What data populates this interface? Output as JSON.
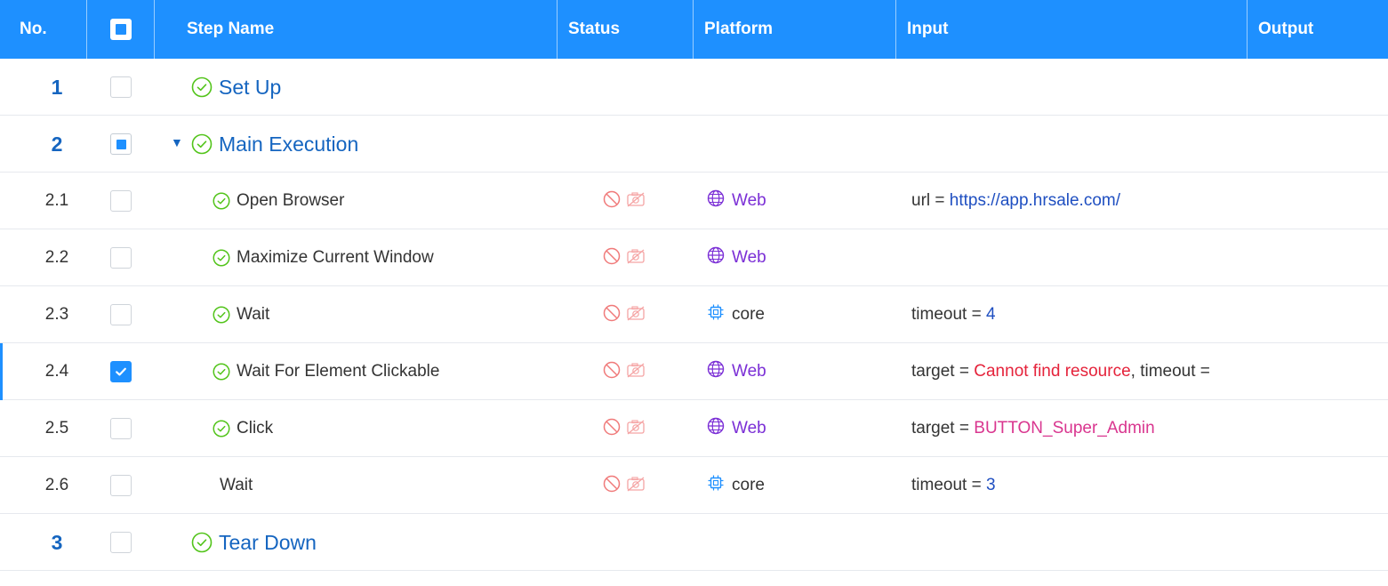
{
  "header": {
    "no": "No.",
    "step_name": "Step Name",
    "status": "Status",
    "platform": "Platform",
    "input": "Input",
    "output": "Output"
  },
  "rows": [
    {
      "no": "1",
      "name": "Set Up"
    },
    {
      "no": "2",
      "name": "Main Execution"
    },
    {
      "no": "2.1",
      "name": "Open Browser",
      "platform": "Web",
      "input_key": "url",
      "input_eq": "=",
      "input_value": "https://app.hrsale.com/"
    },
    {
      "no": "2.2",
      "name": "Maximize Current Window",
      "platform": "Web"
    },
    {
      "no": "2.3",
      "name": "Wait",
      "platform": "core",
      "input_key": "timeout",
      "input_eq": "=",
      "input_value": "4"
    },
    {
      "no": "2.4",
      "name": "Wait For Element Clickable",
      "platform": "Web",
      "input_key": "target",
      "input_eq": "=",
      "input_value": "Cannot find resource",
      "input_extra": ", timeout ="
    },
    {
      "no": "2.5",
      "name": "Click",
      "platform": "Web",
      "input_key": "target",
      "input_eq": "=",
      "input_value": "BUTTON_Super_Admin"
    },
    {
      "no": "2.6",
      "name": "Wait",
      "platform": "core",
      "input_key": "timeout",
      "input_eq": "=",
      "input_value": "3"
    },
    {
      "no": "3",
      "name": "Tear Down"
    }
  ],
  "icons": {
    "passed": "check-circle-icon",
    "disabled": "ban-icon",
    "no-screenshot": "camera-off-icon",
    "web": "globe-icon",
    "core": "chip-icon",
    "expand": "caret-down-icon"
  },
  "colors": {
    "header_bg": "#1e90ff",
    "group_text": "#1565c0",
    "success": "#52c41a",
    "web": "#7b2fd6",
    "core": "#1e90ff",
    "error": "#e5233b",
    "object": "#d9368f",
    "link": "#1f4fc1",
    "status_icon": "#f07a7a"
  }
}
